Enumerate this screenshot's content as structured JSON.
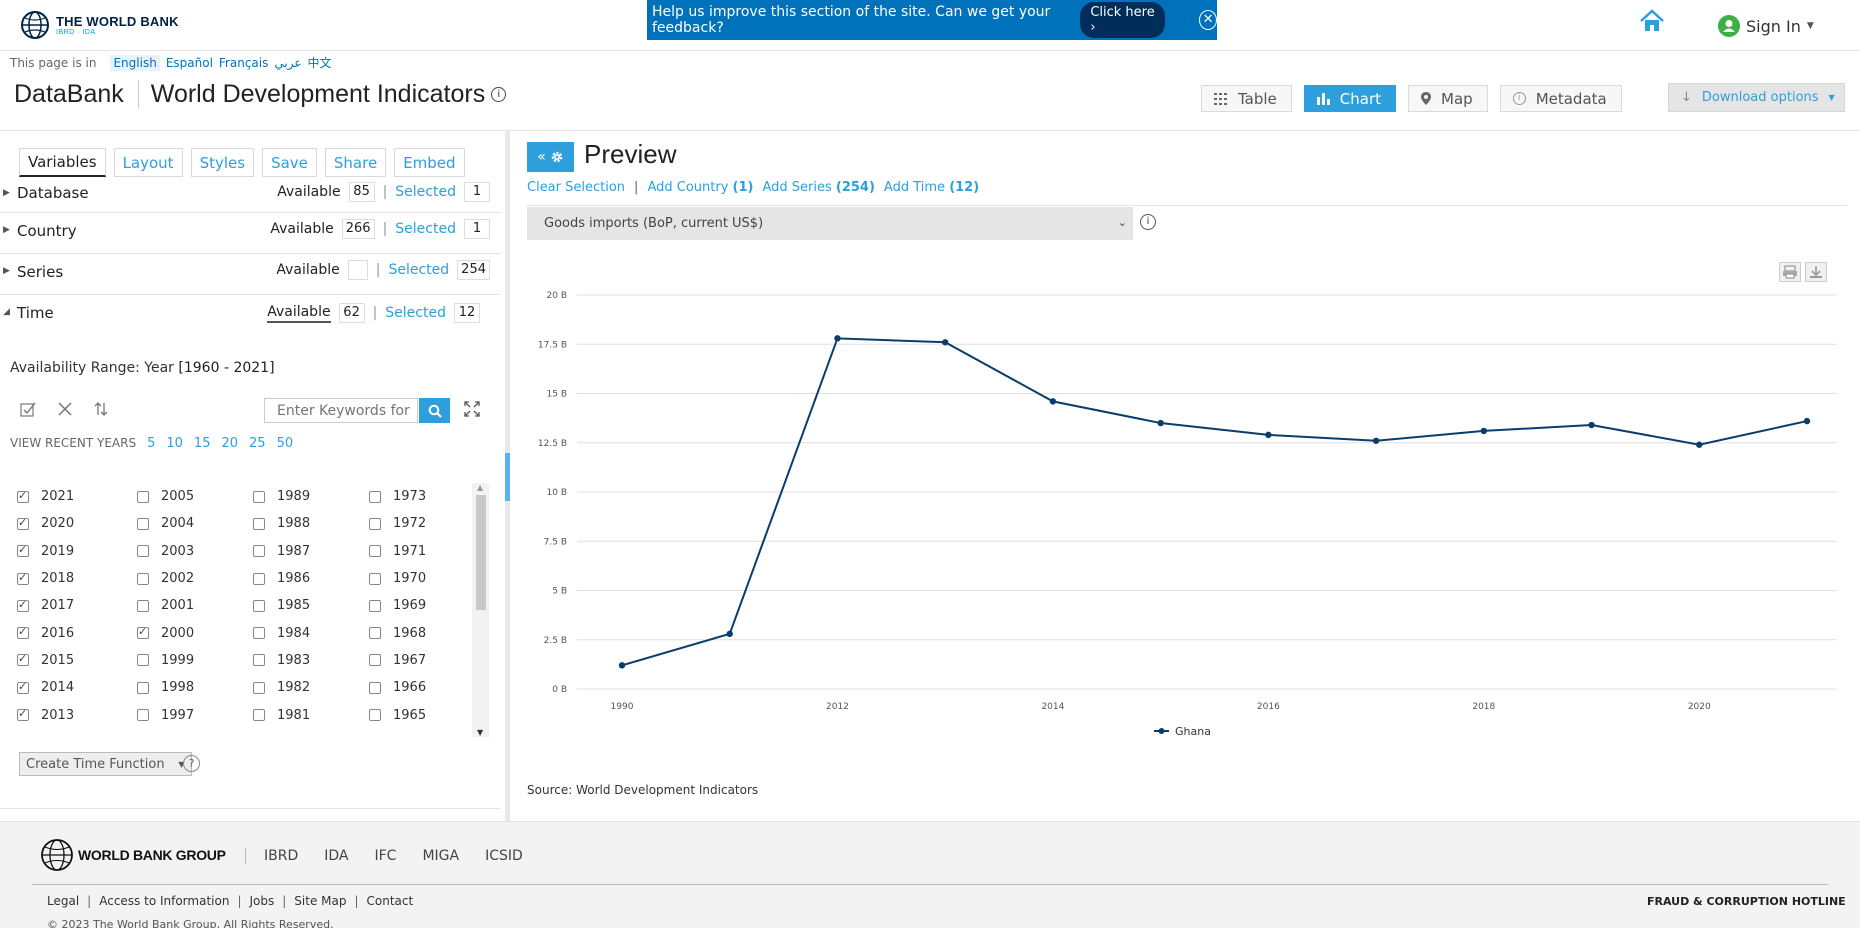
{
  "header": {
    "logo_title": "THE WORLD BANK",
    "logo_sub": "IBRD · IDA",
    "feedback_text": "Help us improve this section of the site. Can we get your feedback?",
    "feedback_button": "Click here ›",
    "close_symbol": "✕",
    "signin": "Sign In"
  },
  "language": {
    "prefix": "This page is in",
    "options": [
      "English",
      "Español",
      "Français",
      "عربي",
      "中文"
    ]
  },
  "title": {
    "brand": "DataBank",
    "database": "World Development Indicators"
  },
  "views": {
    "table": "Table",
    "chart": "Chart",
    "map": "Map",
    "metadata": "Metadata",
    "download": "Download options"
  },
  "left_panel": {
    "tabs": [
      "Variables",
      "Layout",
      "Styles",
      "Save",
      "Share",
      "Embed"
    ],
    "available_label": "Available",
    "selected_label": "Selected",
    "sections": [
      {
        "label": "Database",
        "available": "85",
        "selected": "1"
      },
      {
        "label": "Country",
        "available": "266",
        "selected": "1"
      },
      {
        "label": "Series",
        "available": "",
        "selected": "254"
      },
      {
        "label": "Time",
        "available": "62",
        "selected": "12"
      }
    ],
    "range_prefix": "Availability Range: Year",
    "range_value": "[1960 - 2021]",
    "keyword_placeholder": "Enter Keywords for",
    "recent_label": "VIEW RECENT YEARS",
    "recent_options": [
      "5",
      "10",
      "15",
      "20",
      "25",
      "50"
    ],
    "years": [
      [
        {
          "y": "2021",
          "c": true
        },
        {
          "y": "2020",
          "c": true
        },
        {
          "y": "2019",
          "c": true
        },
        {
          "y": "2018",
          "c": true
        },
        {
          "y": "2017",
          "c": true
        },
        {
          "y": "2016",
          "c": true
        },
        {
          "y": "2015",
          "c": true
        },
        {
          "y": "2014",
          "c": true
        },
        {
          "y": "2013",
          "c": true
        }
      ],
      [
        {
          "y": "2005",
          "c": false
        },
        {
          "y": "2004",
          "c": false
        },
        {
          "y": "2003",
          "c": false
        },
        {
          "y": "2002",
          "c": false
        },
        {
          "y": "2001",
          "c": false
        },
        {
          "y": "2000",
          "c": true
        },
        {
          "y": "1999",
          "c": false
        },
        {
          "y": "1998",
          "c": false
        },
        {
          "y": "1997",
          "c": false
        }
      ],
      [
        {
          "y": "1989",
          "c": false
        },
        {
          "y": "1988",
          "c": false
        },
        {
          "y": "1987",
          "c": false
        },
        {
          "y": "1986",
          "c": false
        },
        {
          "y": "1985",
          "c": false
        },
        {
          "y": "1984",
          "c": false
        },
        {
          "y": "1983",
          "c": false
        },
        {
          "y": "1982",
          "c": false
        },
        {
          "y": "1981",
          "c": false
        }
      ],
      [
        {
          "y": "1973",
          "c": false
        },
        {
          "y": "1972",
          "c": false
        },
        {
          "y": "1971",
          "c": false
        },
        {
          "y": "1970",
          "c": false
        },
        {
          "y": "1969",
          "c": false
        },
        {
          "y": "1968",
          "c": false
        },
        {
          "y": "1967",
          "c": false
        },
        {
          "y": "1966",
          "c": false
        },
        {
          "y": "1965",
          "c": false
        }
      ]
    ],
    "time_function": "Create Time Function"
  },
  "preview": {
    "title": "Preview",
    "clear": "Clear Selection",
    "add_country": "Add Country",
    "add_country_count": "(1)",
    "add_series": "Add Series",
    "add_series_count": "(254)",
    "add_time": "Add Time",
    "add_time_count": "(12)",
    "series_selected": "Goods imports (BoP, current US$)",
    "source": "Source: World Development Indicators"
  },
  "chart_data": {
    "type": "line",
    "x": [
      "1990",
      "2000",
      "2012",
      "2013",
      "2014",
      "2015",
      "2016",
      "2017",
      "2018",
      "2019",
      "2020",
      "2021"
    ],
    "x_tick_labels": [
      "1990",
      "2012",
      "2014",
      "2016",
      "2018",
      "2020"
    ],
    "y_tick_labels": [
      "0 B",
      "2.5 B",
      "5 B",
      "7.5 B",
      "10 B",
      "12.5 B",
      "15 B",
      "17.5 B",
      "20 B"
    ],
    "ylim": [
      0,
      20
    ],
    "series": [
      {
        "name": "Ghana",
        "values": [
          1.2,
          2.8,
          17.8,
          17.6,
          14.6,
          13.5,
          12.9,
          12.6,
          13.1,
          13.4,
          12.4,
          13.6
        ]
      }
    ],
    "legend_position": "bottom-center",
    "grid": true,
    "color": "#0b3d6b"
  },
  "footer": {
    "group": "WORLD BANK GROUP",
    "orgs": [
      "IBRD",
      "IDA",
      "IFC",
      "MIGA",
      "ICSID"
    ],
    "links": [
      "Legal",
      "Access to Information",
      "Jobs",
      "Site Map",
      "Contact"
    ],
    "fraud": "FRAUD & CORRUPTION HOTLINE",
    "copyright": "© 2023 The World Bank Group, All Rights Reserved."
  }
}
